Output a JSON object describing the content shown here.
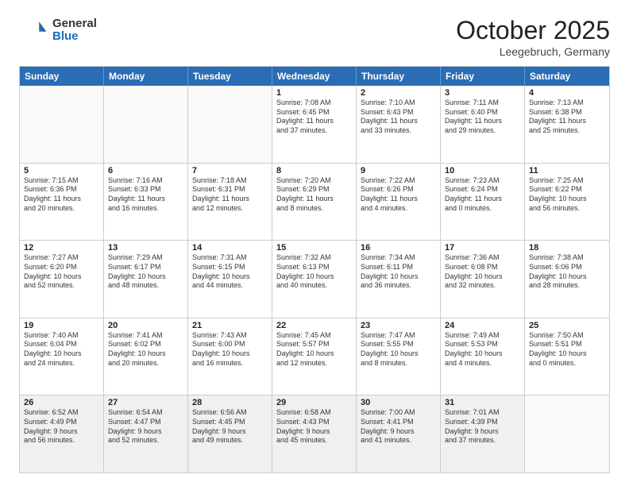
{
  "logo": {
    "general": "General",
    "blue": "Blue"
  },
  "header": {
    "month": "October 2025",
    "location": "Leegebruch, Germany"
  },
  "days_of_week": [
    "Sunday",
    "Monday",
    "Tuesday",
    "Wednesday",
    "Thursday",
    "Friday",
    "Saturday"
  ],
  "weeks": [
    [
      {
        "day": "",
        "empty": true
      },
      {
        "day": "",
        "empty": true
      },
      {
        "day": "",
        "empty": true
      },
      {
        "day": "1",
        "lines": [
          "Sunrise: 7:08 AM",
          "Sunset: 6:45 PM",
          "Daylight: 11 hours",
          "and 37 minutes."
        ]
      },
      {
        "day": "2",
        "lines": [
          "Sunrise: 7:10 AM",
          "Sunset: 6:43 PM",
          "Daylight: 11 hours",
          "and 33 minutes."
        ]
      },
      {
        "day": "3",
        "lines": [
          "Sunrise: 7:11 AM",
          "Sunset: 6:40 PM",
          "Daylight: 11 hours",
          "and 29 minutes."
        ]
      },
      {
        "day": "4",
        "lines": [
          "Sunrise: 7:13 AM",
          "Sunset: 6:38 PM",
          "Daylight: 11 hours",
          "and 25 minutes."
        ]
      }
    ],
    [
      {
        "day": "5",
        "lines": [
          "Sunrise: 7:15 AM",
          "Sunset: 6:36 PM",
          "Daylight: 11 hours",
          "and 20 minutes."
        ]
      },
      {
        "day": "6",
        "lines": [
          "Sunrise: 7:16 AM",
          "Sunset: 6:33 PM",
          "Daylight: 11 hours",
          "and 16 minutes."
        ]
      },
      {
        "day": "7",
        "lines": [
          "Sunrise: 7:18 AM",
          "Sunset: 6:31 PM",
          "Daylight: 11 hours",
          "and 12 minutes."
        ]
      },
      {
        "day": "8",
        "lines": [
          "Sunrise: 7:20 AM",
          "Sunset: 6:29 PM",
          "Daylight: 11 hours",
          "and 8 minutes."
        ]
      },
      {
        "day": "9",
        "lines": [
          "Sunrise: 7:22 AM",
          "Sunset: 6:26 PM",
          "Daylight: 11 hours",
          "and 4 minutes."
        ]
      },
      {
        "day": "10",
        "lines": [
          "Sunrise: 7:23 AM",
          "Sunset: 6:24 PM",
          "Daylight: 11 hours",
          "and 0 minutes."
        ]
      },
      {
        "day": "11",
        "lines": [
          "Sunrise: 7:25 AM",
          "Sunset: 6:22 PM",
          "Daylight: 10 hours",
          "and 56 minutes."
        ]
      }
    ],
    [
      {
        "day": "12",
        "lines": [
          "Sunrise: 7:27 AM",
          "Sunset: 6:20 PM",
          "Daylight: 10 hours",
          "and 52 minutes."
        ]
      },
      {
        "day": "13",
        "lines": [
          "Sunrise: 7:29 AM",
          "Sunset: 6:17 PM",
          "Daylight: 10 hours",
          "and 48 minutes."
        ]
      },
      {
        "day": "14",
        "lines": [
          "Sunrise: 7:31 AM",
          "Sunset: 6:15 PM",
          "Daylight: 10 hours",
          "and 44 minutes."
        ]
      },
      {
        "day": "15",
        "lines": [
          "Sunrise: 7:32 AM",
          "Sunset: 6:13 PM",
          "Daylight: 10 hours",
          "and 40 minutes."
        ]
      },
      {
        "day": "16",
        "lines": [
          "Sunrise: 7:34 AM",
          "Sunset: 6:11 PM",
          "Daylight: 10 hours",
          "and 36 minutes."
        ]
      },
      {
        "day": "17",
        "lines": [
          "Sunrise: 7:36 AM",
          "Sunset: 6:08 PM",
          "Daylight: 10 hours",
          "and 32 minutes."
        ]
      },
      {
        "day": "18",
        "lines": [
          "Sunrise: 7:38 AM",
          "Sunset: 6:06 PM",
          "Daylight: 10 hours",
          "and 28 minutes."
        ]
      }
    ],
    [
      {
        "day": "19",
        "lines": [
          "Sunrise: 7:40 AM",
          "Sunset: 6:04 PM",
          "Daylight: 10 hours",
          "and 24 minutes."
        ]
      },
      {
        "day": "20",
        "lines": [
          "Sunrise: 7:41 AM",
          "Sunset: 6:02 PM",
          "Daylight: 10 hours",
          "and 20 minutes."
        ]
      },
      {
        "day": "21",
        "lines": [
          "Sunrise: 7:43 AM",
          "Sunset: 6:00 PM",
          "Daylight: 10 hours",
          "and 16 minutes."
        ]
      },
      {
        "day": "22",
        "lines": [
          "Sunrise: 7:45 AM",
          "Sunset: 5:57 PM",
          "Daylight: 10 hours",
          "and 12 minutes."
        ]
      },
      {
        "day": "23",
        "lines": [
          "Sunrise: 7:47 AM",
          "Sunset: 5:55 PM",
          "Daylight: 10 hours",
          "and 8 minutes."
        ]
      },
      {
        "day": "24",
        "lines": [
          "Sunrise: 7:49 AM",
          "Sunset: 5:53 PM",
          "Daylight: 10 hours",
          "and 4 minutes."
        ]
      },
      {
        "day": "25",
        "lines": [
          "Sunrise: 7:50 AM",
          "Sunset: 5:51 PM",
          "Daylight: 10 hours",
          "and 0 minutes."
        ]
      }
    ],
    [
      {
        "day": "26",
        "lines": [
          "Sunrise: 6:52 AM",
          "Sunset: 4:49 PM",
          "Daylight: 9 hours",
          "and 56 minutes."
        ]
      },
      {
        "day": "27",
        "lines": [
          "Sunrise: 6:54 AM",
          "Sunset: 4:47 PM",
          "Daylight: 9 hours",
          "and 52 minutes."
        ]
      },
      {
        "day": "28",
        "lines": [
          "Sunrise: 6:56 AM",
          "Sunset: 4:45 PM",
          "Daylight: 9 hours",
          "and 49 minutes."
        ]
      },
      {
        "day": "29",
        "lines": [
          "Sunrise: 6:58 AM",
          "Sunset: 4:43 PM",
          "Daylight: 9 hours",
          "and 45 minutes."
        ]
      },
      {
        "day": "30",
        "lines": [
          "Sunrise: 7:00 AM",
          "Sunset: 4:41 PM",
          "Daylight: 9 hours",
          "and 41 minutes."
        ]
      },
      {
        "day": "31",
        "lines": [
          "Sunrise: 7:01 AM",
          "Sunset: 4:39 PM",
          "Daylight: 9 hours",
          "and 37 minutes."
        ]
      },
      {
        "day": "",
        "empty": true
      }
    ]
  ]
}
